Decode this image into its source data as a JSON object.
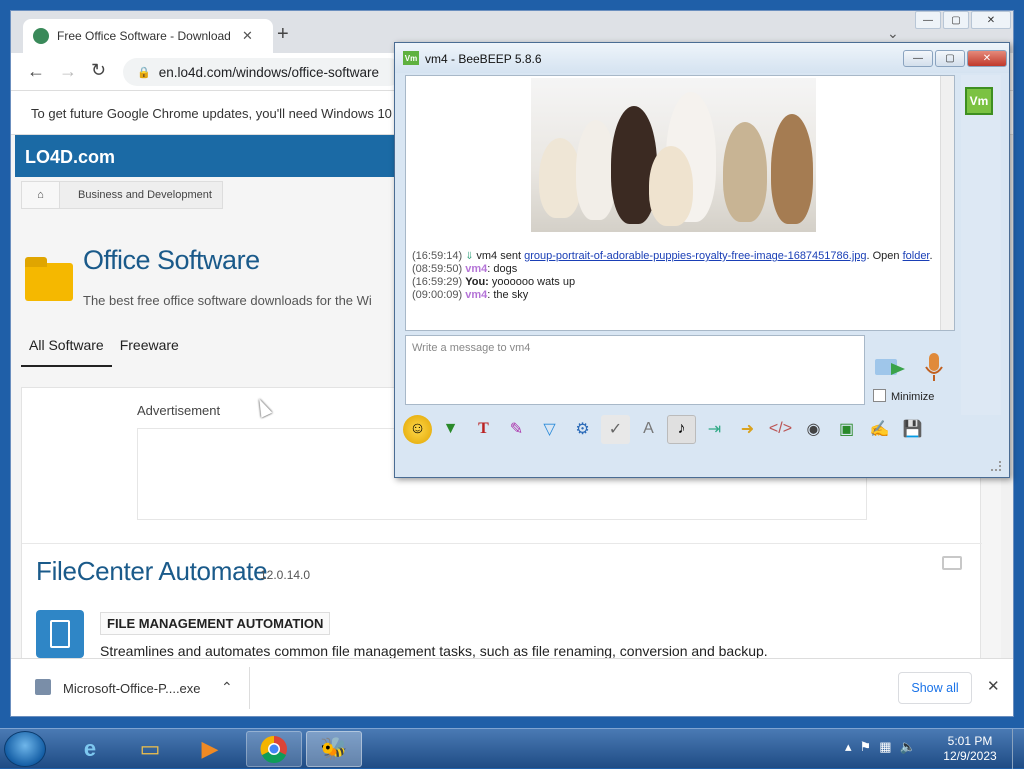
{
  "browser": {
    "tab_title": "Free Office Software - Download",
    "new_tab": "+",
    "url": "en.lo4d.com/windows/office-software",
    "info_message": "To get future Google Chrome updates, you'll need Windows 10",
    "chevron": "⌄"
  },
  "site": {
    "logo": "LO4D.com",
    "breadcrumb": "Business and Development",
    "page_title": "Office Software",
    "subtitle": "The best free office software downloads for the Wi",
    "tabs": [
      "All Software",
      "Freeware"
    ],
    "advertisement": "Advertisement",
    "product": {
      "name": "FileCenter Automate",
      "version": "12.0.14.0",
      "category": "FILE MANAGEMENT AUTOMATION",
      "description": "Streamlines and automates common file management tasks, such as file renaming, conversion and backup."
    }
  },
  "downloads": {
    "file": "Microsoft-Office-P....exe",
    "show_all": "Show all",
    "close": "✕"
  },
  "beebeep": {
    "title": "vm4 - BeeBEEP 5.8.6",
    "app_icon": "Vm",
    "messages": [
      {
        "ts": "(16:59:14)",
        "pre": "vm4 sent ",
        "link": "group-portrait-of-adorable-puppies-royalty-free-image-1687451786.jpg",
        "post": ". Open ",
        "link2": "folder",
        "end": "."
      },
      {
        "ts": "(08:59:50)",
        "who": "vm4",
        "text": ": dogs"
      },
      {
        "ts": "(16:59:29)",
        "who": "You:",
        "text": " yoooooo wats up"
      },
      {
        "ts": "(09:00:09)",
        "who": "vm4",
        "text": ": the sky"
      }
    ],
    "input_placeholder": "Write a message to vm4",
    "minimize_label": "Minimize",
    "user_avatar": "Vm"
  },
  "taskbar": {
    "time": "5:01 PM",
    "date": "12/9/2023"
  }
}
